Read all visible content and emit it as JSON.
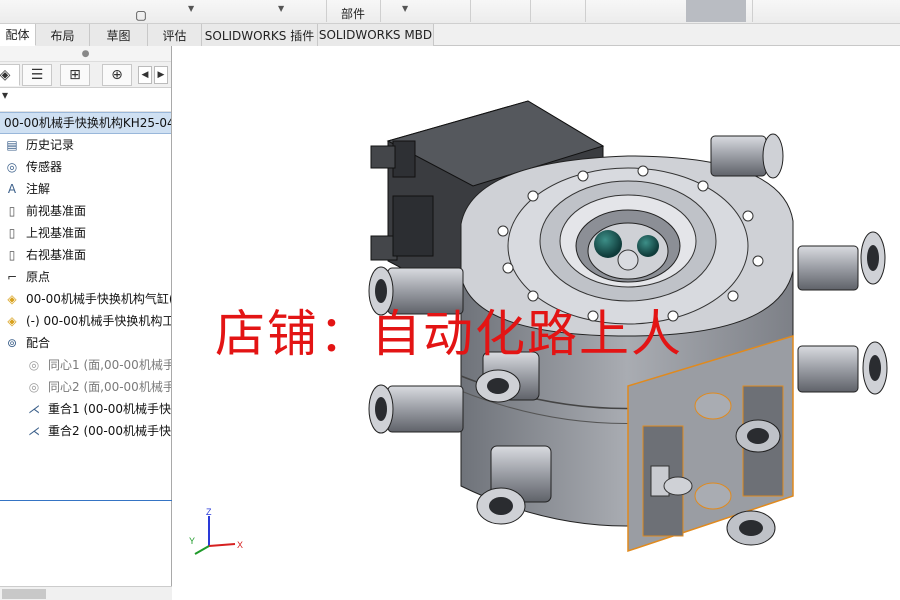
{
  "ribbon": {
    "parts_label": "部件"
  },
  "tabs": [
    {
      "label": "配体",
      "active": true
    },
    {
      "label": "布局",
      "active": false
    },
    {
      "label": "草图",
      "active": false
    },
    {
      "label": "评估",
      "active": false
    },
    {
      "label": "SOLIDWORKS 插件",
      "active": false
    },
    {
      "label": "SOLIDWORKS MBD",
      "active": false
    }
  ],
  "heads_up_icons": [
    "zoom-to-fit-icon",
    "zoom-area-icon",
    "previous-view-icon",
    "section-view-icon",
    "dynamic-annotation-icon",
    "view-orientation-icon",
    "display-style-icon",
    "hide-show-icon",
    "appearance-icon",
    "scene-icon"
  ],
  "feature_manager": {
    "filter_label": "▾",
    "root": "00-00机械手快换机构KH25-04",
    "items": [
      {
        "label": "历史记录",
        "icon": "history-icon",
        "kind": "top"
      },
      {
        "label": "传感器",
        "icon": "sensor-icon",
        "kind": "top"
      },
      {
        "label": "注解",
        "icon": "annotation-icon",
        "kind": "top"
      },
      {
        "label": "前视基准面",
        "icon": "plane-icon",
        "kind": "top"
      },
      {
        "label": "上视基准面",
        "icon": "plane-icon",
        "kind": "top"
      },
      {
        "label": "右视基准面",
        "icon": "plane-icon",
        "kind": "top"
      },
      {
        "label": "原点",
        "icon": "origin-icon",
        "kind": "top"
      },
      {
        "label": "00-00机械手快换机构气缸(",
        "icon": "part-icon",
        "kind": "top"
      },
      {
        "label": "(-) 00-00机械手快换机构工",
        "icon": "part-icon",
        "kind": "top"
      },
      {
        "label": "配合",
        "icon": "mates-icon",
        "kind": "top"
      },
      {
        "label": "同心1 (面,00-00机械手",
        "icon": "concentric-icon",
        "kind": "sub"
      },
      {
        "label": "同心2 (面,00-00机械手",
        "icon": "concentric-icon",
        "kind": "sub"
      },
      {
        "label": "重合1 (00-00机械手快",
        "icon": "coincident-icon",
        "kind": "mate"
      },
      {
        "label": "重合2 (00-00机械手快",
        "icon": "coincident-icon",
        "kind": "mate"
      }
    ]
  },
  "viewport": {
    "watermark": "店铺：自动化路上人",
    "triad": {
      "x": "X",
      "y": "Y",
      "z": "Z"
    }
  },
  "colors": {
    "watermark": "#e31414",
    "selection_blue": "#cfe0f2",
    "model_gray": "#8c8f96",
    "model_light": "#cfd1d6",
    "edge_highlight": "#e08a1e"
  }
}
